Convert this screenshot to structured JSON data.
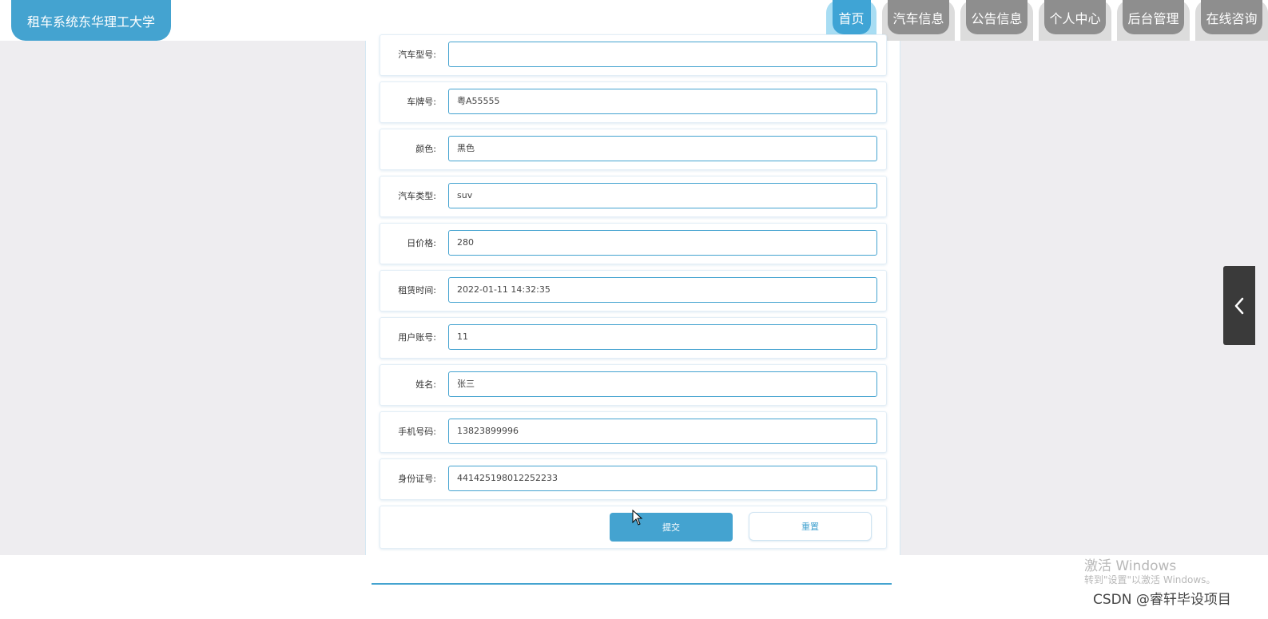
{
  "header": {
    "brand": "租车系统东华理工大学",
    "nav": [
      "首页",
      "汽车信息",
      "公告信息",
      "个人中心",
      "后台管理",
      "在线咨询"
    ],
    "active_nav": "首页"
  },
  "form": {
    "fields": [
      {
        "label": "汽车型号:",
        "value": ""
      },
      {
        "label": "车牌号:",
        "value": "粤A55555"
      },
      {
        "label": "颜色:",
        "value": "黑色"
      },
      {
        "label": "汽车类型:",
        "value": "suv"
      },
      {
        "label": "日价格:",
        "value": "280"
      },
      {
        "label": "租赁时间:",
        "value": "2022-01-11 14:32:35"
      },
      {
        "label": "用户账号:",
        "value": "11"
      },
      {
        "label": "姓名:",
        "value": "张三"
      },
      {
        "label": "手机号码:",
        "value": "13823899996"
      },
      {
        "label": "身份证号:",
        "value": "441425198012252233"
      }
    ],
    "submit_label": "提交",
    "reset_label": "重置"
  },
  "overlay": {
    "activate_title": "激活 Windows",
    "activate_sub": "转到\"设置\"以激活 Windows。",
    "csdn": "CSDN @睿轩毕设项目"
  },
  "colors": {
    "accent": "#44a3d0",
    "nav_inactive": "#8e8e8e",
    "background": "#eeedf0"
  },
  "icons": {
    "side_toggle": "chevron-left-icon",
    "cursor": "mouse-pointer-icon"
  }
}
